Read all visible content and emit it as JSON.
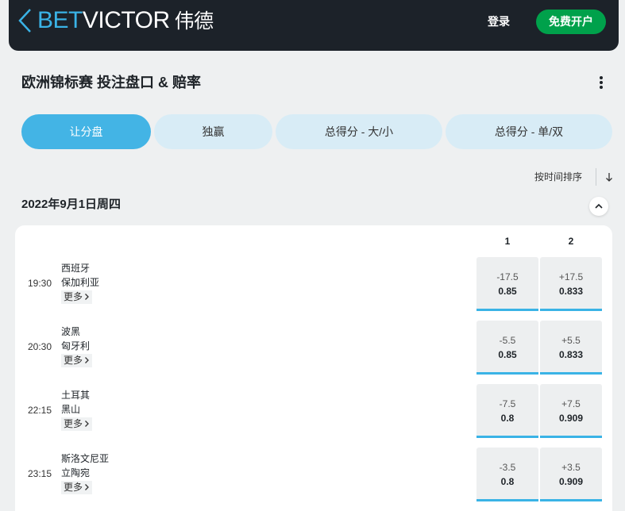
{
  "header": {
    "brand_bet": "BET",
    "brand_victor": "VICTOR",
    "brand_cn": "伟德",
    "login_label": "登录",
    "signup_label": "免费开户"
  },
  "page": {
    "title": "欧洲锦标赛 投注盘口 & 赔率"
  },
  "tabs": [
    {
      "label": "让分盘",
      "active": true
    },
    {
      "label": "独赢",
      "active": false
    },
    {
      "label": "总得分 - 大/小",
      "active": false
    },
    {
      "label": "总得分 - 单/双",
      "active": false
    }
  ],
  "sort": {
    "label": "按时间排序"
  },
  "section": {
    "date": "2022年9月1日周四",
    "col1": "1",
    "col2": "2"
  },
  "events": [
    {
      "time": "19:30",
      "home": "西班牙",
      "away": "保加利亚",
      "more": "更多",
      "odds1_line": "-17.5",
      "odds1_price": "0.85",
      "odds2_line": "+17.5",
      "odds2_price": "0.833"
    },
    {
      "time": "20:30",
      "home": "波黑",
      "away": "匈牙利",
      "more": "更多",
      "odds1_line": "-5.5",
      "odds1_price": "0.85",
      "odds2_line": "+5.5",
      "odds2_price": "0.833"
    },
    {
      "time": "22:15",
      "home": "土耳其",
      "away": "黑山",
      "more": "更多",
      "odds1_line": "-7.5",
      "odds1_price": "0.8",
      "odds2_line": "+7.5",
      "odds2_price": "0.909"
    },
    {
      "time": "23:15",
      "home": "斯洛文尼亚",
      "away": "立陶宛",
      "more": "更多",
      "odds1_line": "-3.5",
      "odds1_price": "0.8",
      "odds2_line": "+3.5",
      "odds2_price": "0.909"
    }
  ],
  "colors": {
    "accent": "#3ab3e6",
    "signup": "#00a14b",
    "header_bg": "#1c2229"
  }
}
